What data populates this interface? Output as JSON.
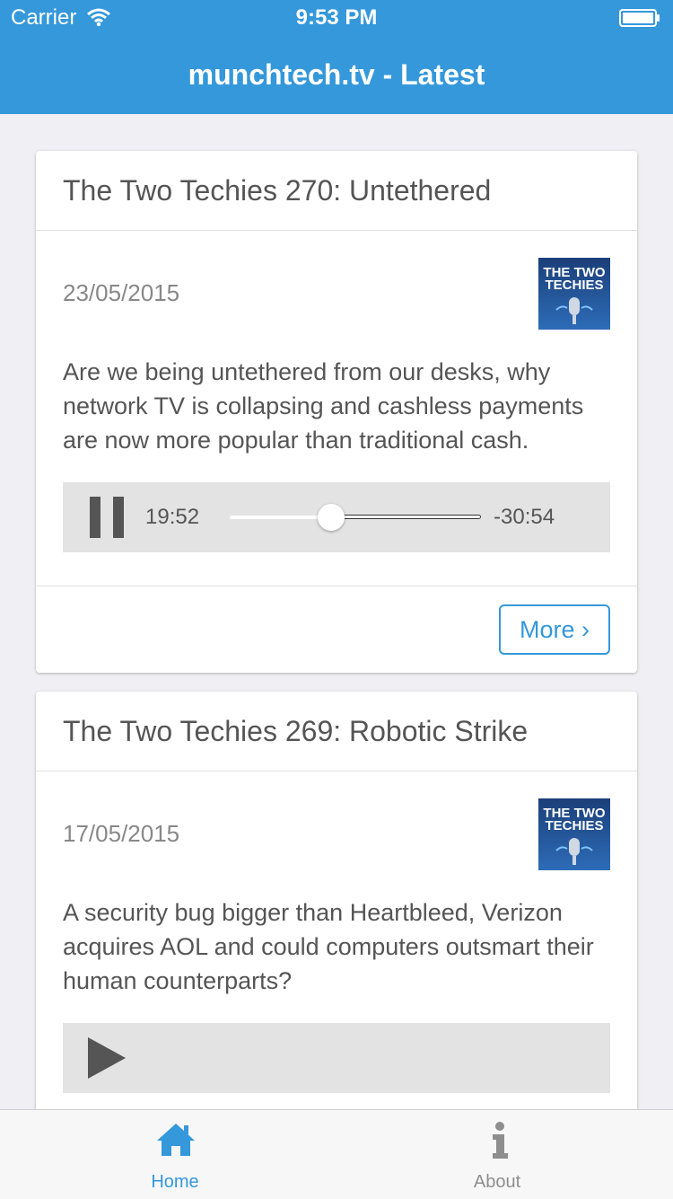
{
  "status_bar": {
    "carrier": "Carrier",
    "time": "9:53 PM"
  },
  "nav": {
    "title": "munchtech.tv - Latest"
  },
  "thumbnail": {
    "line1": "THE TWO",
    "line2": "TECHIES"
  },
  "episodes": [
    {
      "title": "The Two Techies 270: Untethered",
      "date": "23/05/2015",
      "description": "Are we being untethered from our desks, why network TV is collapsing and cashless payments are now more popular than traditional cash.",
      "player": {
        "state": "playing",
        "elapsed": "19:52",
        "remaining": "-30:54",
        "progress": 0.39
      },
      "more_label": "More ›"
    },
    {
      "title": "The Two Techies 269: Robotic Strike",
      "date": "17/05/2015",
      "description": "A security bug bigger than Heartbleed, Verizon acquires AOL and could computers outsmart their human counterparts?",
      "player": {
        "state": "paused"
      }
    }
  ],
  "tabs": [
    {
      "label": "Home",
      "icon": "home-icon",
      "active": true
    },
    {
      "label": "About",
      "icon": "info-icon",
      "active": false
    }
  ],
  "colors": {
    "accent": "#3498db",
    "tab_inactive": "#8e8e8e",
    "player_bg": "#e3e3e3"
  }
}
